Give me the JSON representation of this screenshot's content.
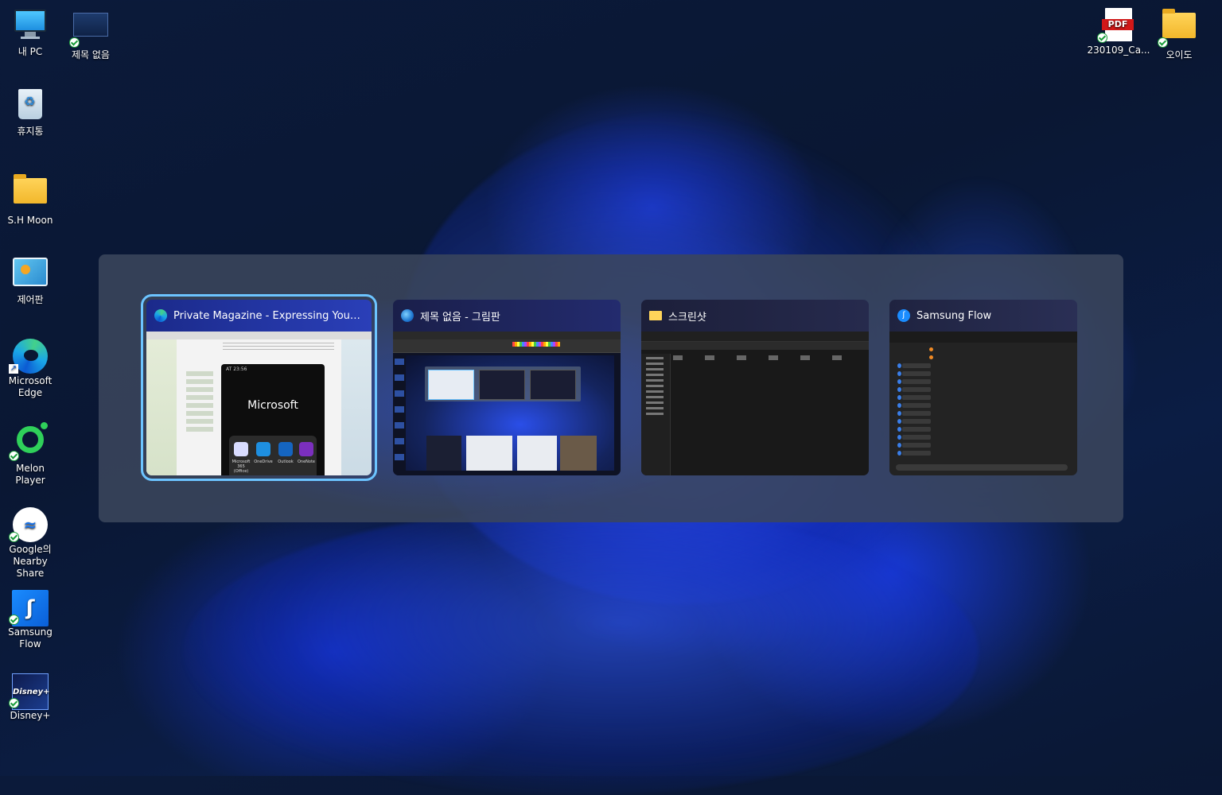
{
  "desktop": {
    "left_icons": [
      {
        "label": "내 PC",
        "icon": "computer-icon"
      },
      {
        "label": "제목 없음",
        "icon": "image-file-icon",
        "synced": true
      },
      {
        "label": "휴지통",
        "icon": "recycle-bin-icon"
      },
      {
        "label": "S.H Moon",
        "icon": "folder-icon"
      },
      {
        "label": "제어판",
        "icon": "control-panel-icon"
      },
      {
        "label": "Microsoft Edge",
        "icon": "edge-icon",
        "shortcut": true
      },
      {
        "label": "Melon Player",
        "icon": "melon-icon",
        "synced": true
      },
      {
        "label": "Google의 Nearby Share",
        "icon": "nearby-share-icon",
        "synced": true
      },
      {
        "label": "Samsung Flow",
        "icon": "samsung-flow-icon",
        "synced": true
      },
      {
        "label": "Disney+",
        "icon": "disney-plus-icon",
        "synced": true
      }
    ],
    "right_icons": [
      {
        "label": "230109_Ca...",
        "icon": "pdf-icon",
        "synced": true
      },
      {
        "label": "오이도",
        "icon": "folder-excel-icon",
        "synced": true
      }
    ]
  },
  "switcher": {
    "windows": [
      {
        "title": "Private Magazine - Expressing Yourself :...",
        "icon": "edge-icon",
        "selected": true,
        "preview": {
          "phone_time": "AT 23:56",
          "brand": "Microsoft",
          "apps": [
            "Microsoft 365 (Office)",
            "OneDrive",
            "Outlook",
            "OneNote"
          ]
        }
      },
      {
        "title": "제목 없음 - 그림판",
        "icon": "paint-icon",
        "selected": false
      },
      {
        "title": "스크린샷",
        "icon": "folder-icon",
        "selected": false
      },
      {
        "title": "Samsung Flow",
        "icon": "samsung-flow-icon",
        "selected": false
      }
    ]
  },
  "colors": {
    "accent": "#6cc4ff",
    "switcher_bg": "#3a465c",
    "wallpaper": "#0b1a3a"
  }
}
